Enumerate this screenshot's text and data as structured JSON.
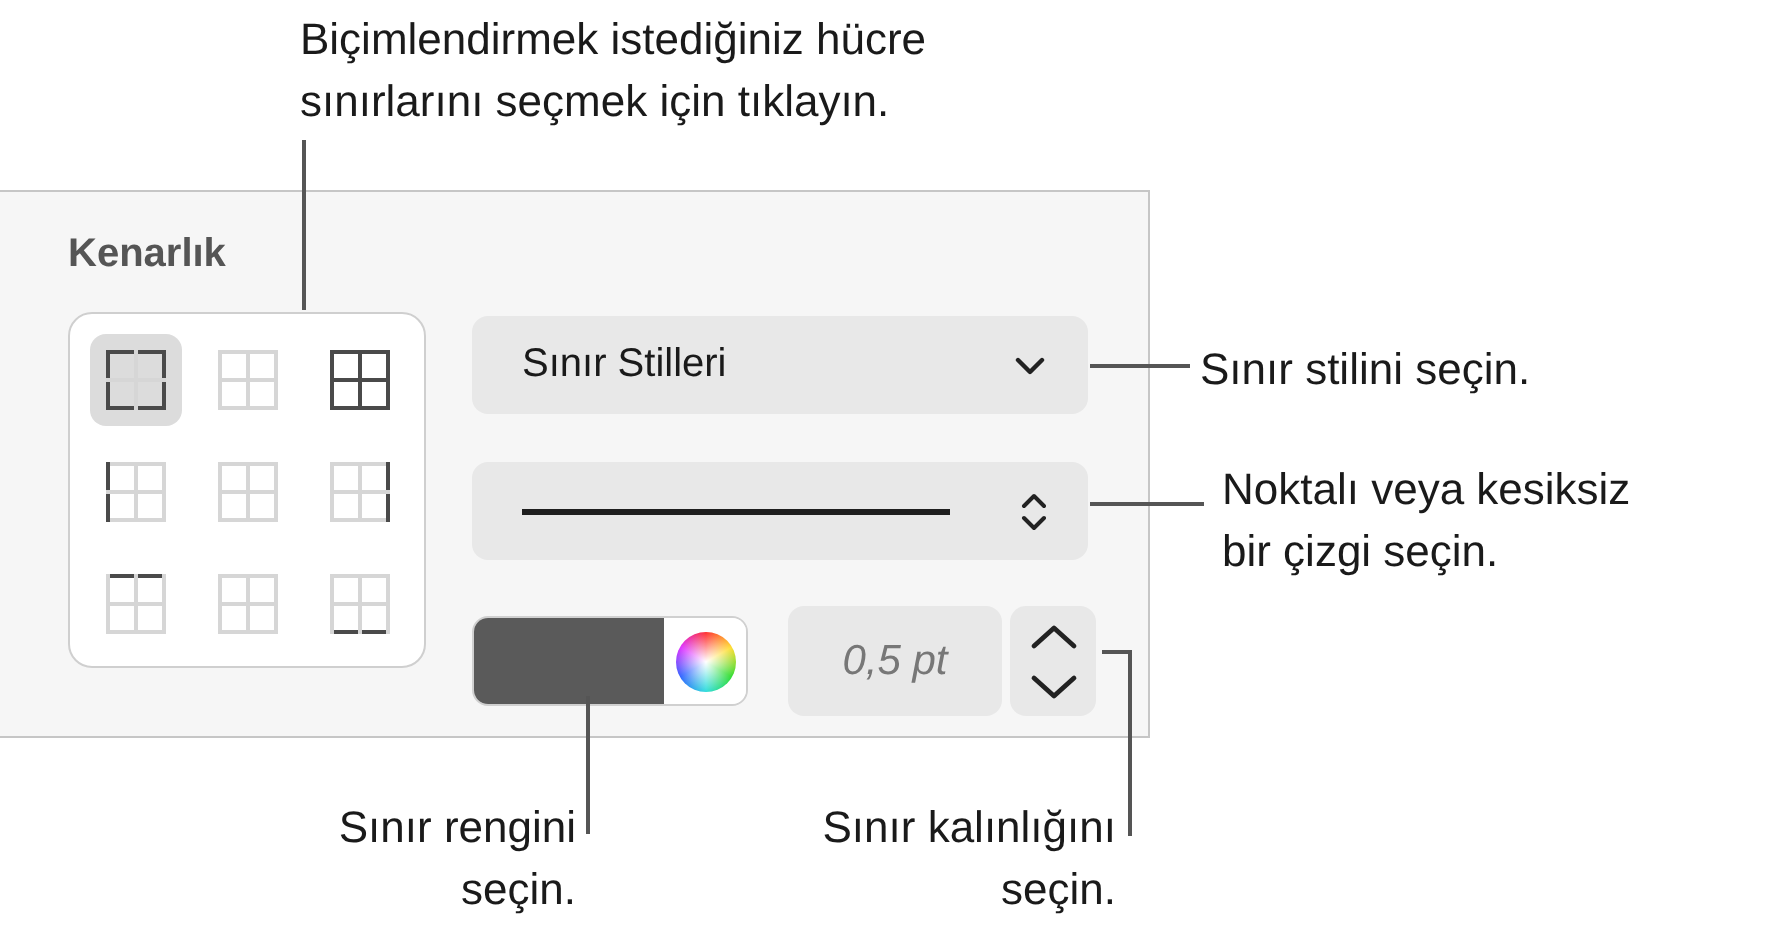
{
  "panel": {
    "title": "Kenarlık",
    "border_buttons": [
      {
        "kind": "outer",
        "selected": true
      },
      {
        "kind": "inner",
        "selected": false
      },
      {
        "kind": "all",
        "selected": false
      },
      {
        "kind": "left",
        "selected": false
      },
      {
        "kind": "inner-vertical",
        "selected": false
      },
      {
        "kind": "right",
        "selected": false
      },
      {
        "kind": "top",
        "selected": false
      },
      {
        "kind": "inner-horizontal",
        "selected": false
      },
      {
        "kind": "bottom",
        "selected": false
      }
    ],
    "style_dropdown": {
      "value": "Sınır Stilleri"
    },
    "thickness": {
      "value": "0,5 pt"
    }
  },
  "callouts": [
    {
      "text": "Biçimlendirmek istediğiniz hücre\nsınırlarını seçmek için tıklayın."
    },
    {
      "text": "Sınır stilini seçin."
    },
    {
      "text": "Noktalı veya kesiksiz\nbir çizgi seçin."
    },
    {
      "text": "Sınır rengini\nseçin."
    },
    {
      "text": "Sınır kalınlığını\nseçin."
    }
  ]
}
